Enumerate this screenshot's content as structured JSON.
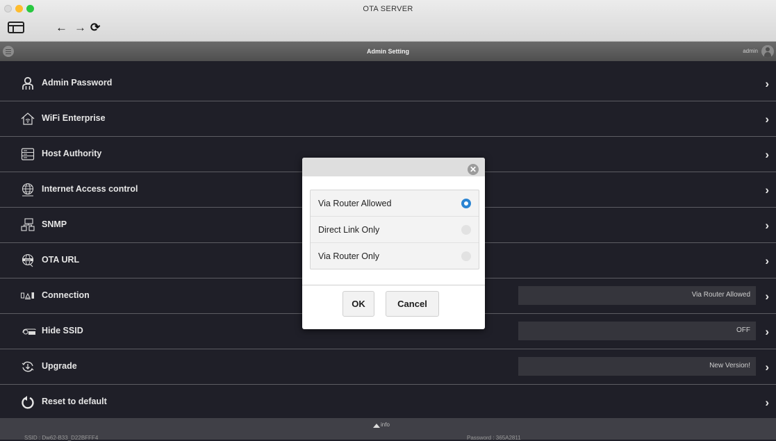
{
  "window": {
    "title": "OTA SERVER"
  },
  "toolbar": {
    "back_icon": "←",
    "forward_icon": "→",
    "reload_icon": "⟳"
  },
  "header": {
    "title": "Admin Setting",
    "user": "admin"
  },
  "menu": {
    "items": [
      {
        "label": "Admin Password",
        "icon": "user-icon"
      },
      {
        "label": "WiFi Enterprise",
        "icon": "house-wifi-icon"
      },
      {
        "label": "Host Authority",
        "icon": "server-icon"
      },
      {
        "label": "Internet Access control",
        "icon": "globe-icon"
      },
      {
        "label": "SNMP",
        "icon": "network-icon"
      },
      {
        "label": "OTA URL",
        "icon": "www-icon"
      },
      {
        "label": "Connection",
        "icon": "connection-icon",
        "value": "Via Router Allowed"
      },
      {
        "label": "Hide SSID",
        "icon": "ssid-icon",
        "value": "OFF"
      },
      {
        "label": "Upgrade",
        "icon": "upgrade-icon",
        "value": "New Version!"
      },
      {
        "label": "Reset to default",
        "icon": "reset-icon"
      }
    ],
    "chevron": "›"
  },
  "dialog": {
    "close_icon": "✕",
    "options": [
      {
        "label": "Via Router Allowed",
        "selected": true
      },
      {
        "label": "Direct Link Only",
        "selected": false
      },
      {
        "label": "Via Router Only",
        "selected": false
      }
    ],
    "ok_label": "OK",
    "cancel_label": "Cancel"
  },
  "footer": {
    "info_label": "info",
    "left_text": "SSID : Dw62-B33_D22BFFF4",
    "right_text": "Password : 365A2811"
  },
  "colors": {
    "background": "#1f1f28",
    "accent": "#2a84d2"
  }
}
